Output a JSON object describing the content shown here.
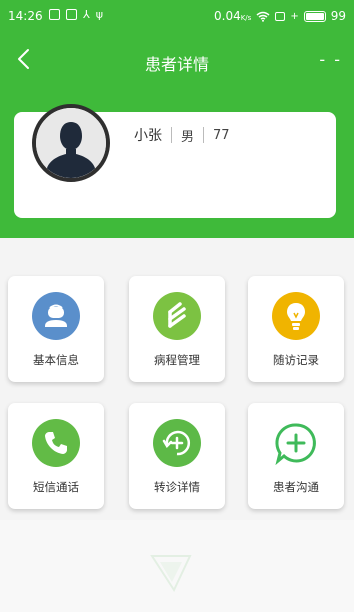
{
  "status_bar": {
    "time": "14:26",
    "data_speed": "0.04",
    "data_unit": "K/s",
    "battery": "99"
  },
  "navbar": {
    "back_icon": "chevron-left-icon",
    "title": "患者详情",
    "more": "- -"
  },
  "patient": {
    "name": "小张",
    "gender": "男",
    "age": "77"
  },
  "menu": [
    {
      "label": "基本信息",
      "icon": "user-icon",
      "color": "#5a8fcb"
    },
    {
      "label": "病程管理",
      "icon": "progress-icon",
      "color": "#7cc242"
    },
    {
      "label": "随访记录",
      "icon": "lightbulb-icon",
      "color": "#f0b400"
    },
    {
      "label": "短信通话",
      "icon": "phone-icon",
      "color": "#62bb46"
    },
    {
      "label": "转诊详情",
      "icon": "transfer-icon",
      "color": "#5db947"
    },
    {
      "label": "患者沟通",
      "icon": "chat-plus-icon",
      "color": "#3fba5a"
    }
  ],
  "colors": {
    "header_green": "#3fba3a",
    "background": "#f4f4f4"
  }
}
